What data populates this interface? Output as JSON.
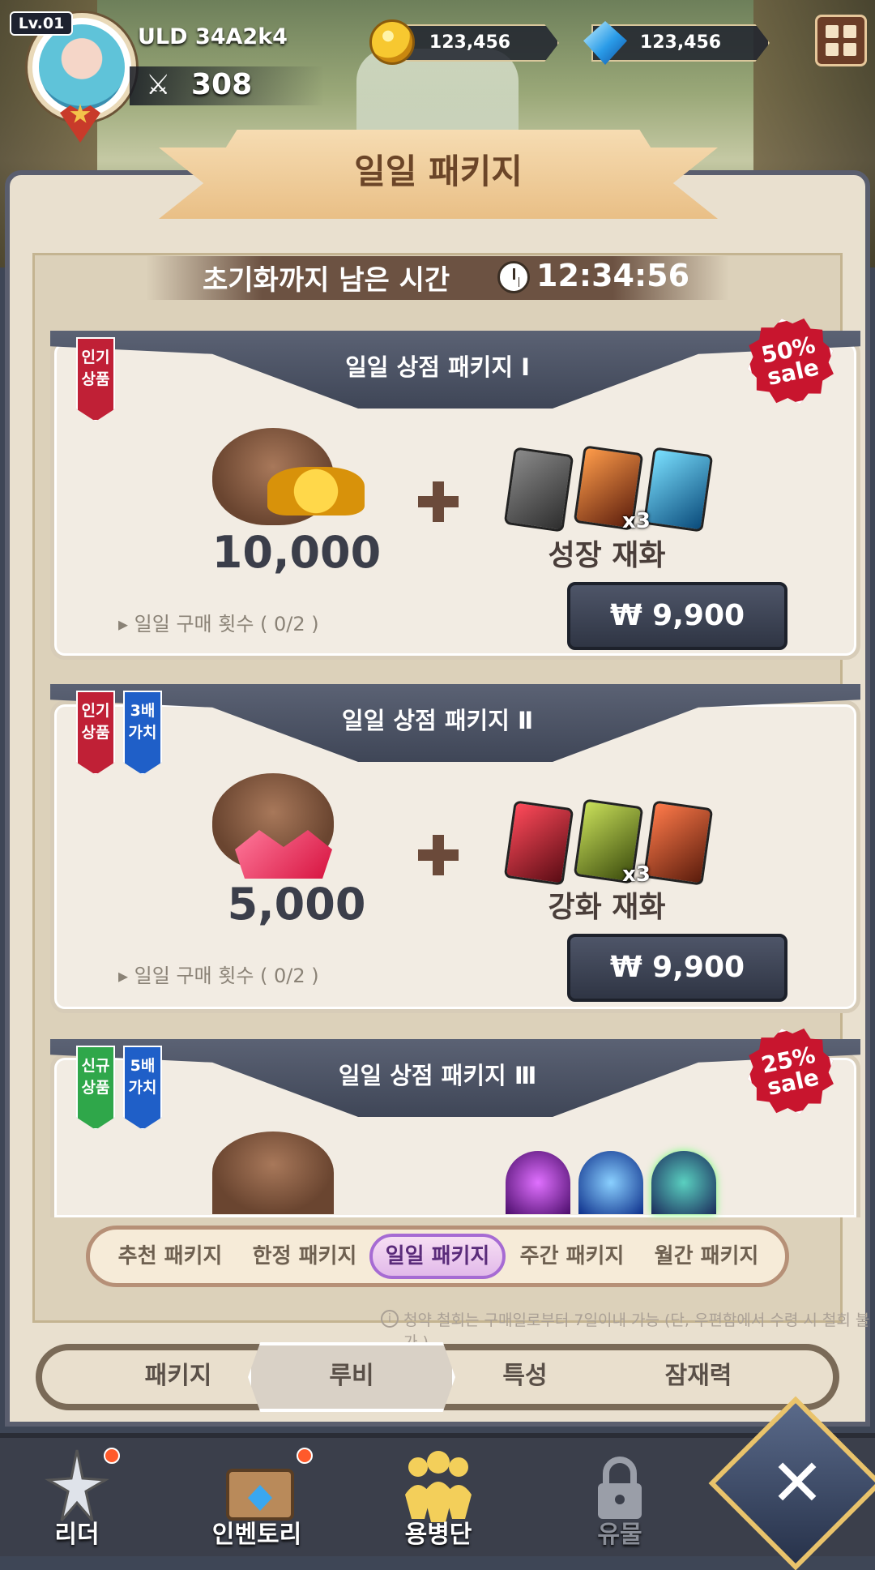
{
  "hud": {
    "level": "Lv.01",
    "username": "ULD 34A2k4",
    "power": "308",
    "gold": "123,456",
    "diamond": "123,456"
  },
  "panel": {
    "title": "일일 패키지",
    "timer_label": "초기화까지 남은 시간",
    "timer": "12:34:56"
  },
  "packages": [
    {
      "title": "일일  상점 패키지 Ⅰ",
      "tags": [
        "인기\n상품"
      ],
      "sale": "50%\nsale",
      "amount": "10,000",
      "item_label": "성장 재화",
      "multiplier": "x3",
      "daily": "▸ 일일 구매 횟수 ( 0/2 )",
      "price": "₩ 9,900"
    },
    {
      "title": "일일  상점 패키지 Ⅱ",
      "tags": [
        "인기\n상품",
        "3배\n가치"
      ],
      "amount": "5,000",
      "item_label": "강화 재화",
      "multiplier": "x3",
      "daily": "▸ 일일 구매 횟수 ( 0/2 )",
      "price": "₩ 9,900"
    },
    {
      "title": "일일  상점 패키지 Ⅲ",
      "tags": [
        "신규\n상품",
        "5배\n가치"
      ],
      "sale": "25%\nsale"
    }
  ],
  "category_tabs": [
    "추천 패키지",
    "한정 패키지",
    "일일 패키지",
    "주간 패키지",
    "월간 패키지"
  ],
  "notice": "청약 철회는 구매일로부터 7일이내 가능 (단, 우편함에서 수령 시 철회 불가 )",
  "sub_tabs": [
    "패키지",
    "루비",
    "특성",
    "잠재력"
  ],
  "bottom_nav": [
    "리더",
    "인벤토리",
    "용병단",
    "유물"
  ],
  "colors": {
    "accent_purple": "#a66bd3",
    "sale_red": "#c8152e",
    "card_header": "#3f4657"
  }
}
